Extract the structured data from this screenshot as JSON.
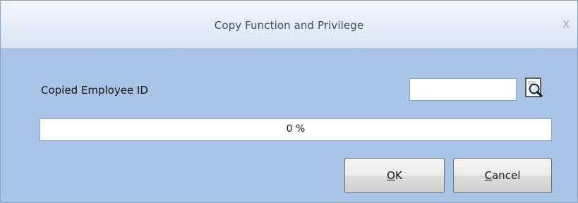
{
  "window": {
    "title": "Copy Function and Privilege",
    "close_glyph": "X"
  },
  "form": {
    "employee_id_label": "Copied Employee ID",
    "employee_id_value": "",
    "lookup_icon": "magnifier-document-icon"
  },
  "progress": {
    "percent": 0,
    "text": "0 %"
  },
  "buttons": {
    "ok": {
      "mnemonic": "O",
      "rest": "K"
    },
    "cancel": {
      "mnemonic": "C",
      "rest": "ancel"
    }
  },
  "colors": {
    "window_background": "#a9c4e6",
    "title_text": "#3b4a64",
    "progress_fill": "#6fb2e8"
  }
}
